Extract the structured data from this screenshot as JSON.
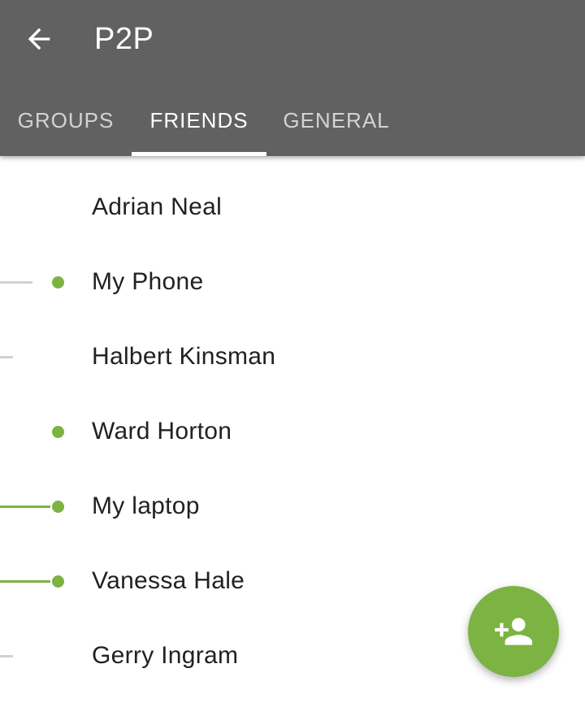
{
  "appbar": {
    "title": "P2P",
    "back_icon": "arrow-back-icon",
    "background": "#616161"
  },
  "tabs": [
    {
      "label": "GROUPS",
      "active": false
    },
    {
      "label": "FRIENDS",
      "active": true
    },
    {
      "label": "GENERAL",
      "active": false
    }
  ],
  "friends": [
    {
      "name": "Adrian Neal",
      "online": false,
      "connection": "none"
    },
    {
      "name": "My Phone",
      "online": true,
      "connection": "inactive"
    },
    {
      "name": "Halbert Kinsman",
      "online": false,
      "connection": "inactive-short"
    },
    {
      "name": "Ward Horton",
      "online": true,
      "connection": "none"
    },
    {
      "name": "My laptop",
      "online": true,
      "connection": "active"
    },
    {
      "name": "Vanessa Hale",
      "online": true,
      "connection": "active"
    },
    {
      "name": "Gerry Ingram",
      "online": false,
      "connection": "inactive-short"
    }
  ],
  "fab": {
    "icon": "person-add-icon"
  },
  "colors": {
    "accent": "#7cb342",
    "inactive_line": "#d0d0d0",
    "text": "#212121"
  }
}
